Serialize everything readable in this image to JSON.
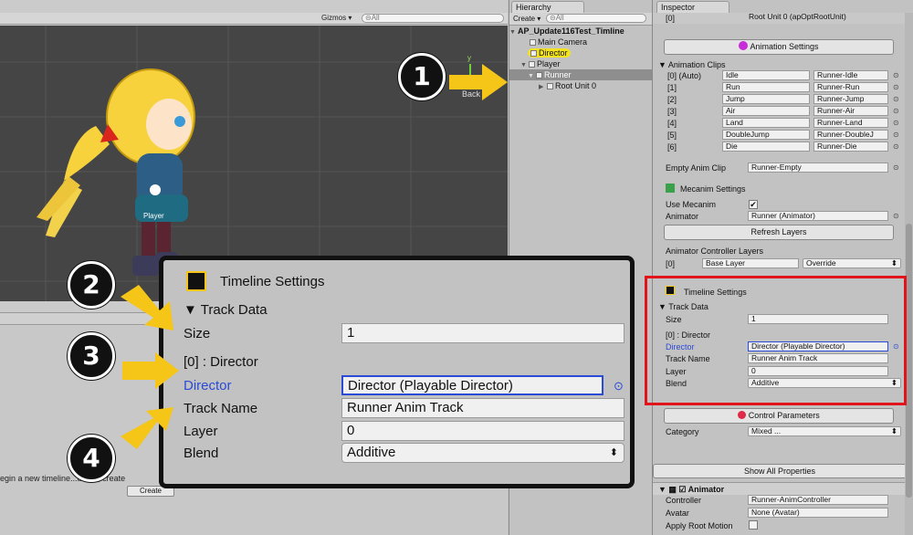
{
  "scene": {
    "gizmos_label": "Gizmos ▾",
    "search_placeholder": "⊝All",
    "gizmo_y": "y",
    "back_label": "Back",
    "player_label": "Player",
    "timeline_msg": "egin a new timeline...unner, create",
    "create_label": "Create"
  },
  "hierarchy": {
    "tab_label": "Hierarchy",
    "create_label": "Create ▾",
    "search_placeholder": "⊝All",
    "scene_name": "AP_Update116Test_Timline",
    "items": [
      {
        "label": "Main Camera"
      },
      {
        "label": "Director"
      },
      {
        "label": "Player"
      },
      {
        "label": "Runner"
      },
      {
        "label": "Root Unit 0"
      }
    ]
  },
  "inspector": {
    "tab_label": "Inspector",
    "top_index": "[0]",
    "top_value": "Root Unit 0 (apOptRootUnit)",
    "animation_settings_label": "Animation Settings",
    "animation_clips_label": "Animation Clips",
    "clips": [
      {
        "index": "[0] (Auto)",
        "name": "Idle",
        "ref": "Runner-Idle"
      },
      {
        "index": "[1]",
        "name": "Run",
        "ref": "Runner-Run"
      },
      {
        "index": "[2]",
        "name": "Jump",
        "ref": "Runner-Jump"
      },
      {
        "index": "[3]",
        "name": "Air",
        "ref": "Runner-Air"
      },
      {
        "index": "[4]",
        "name": "Land",
        "ref": "Runner-Land"
      },
      {
        "index": "[5]",
        "name": "DoubleJump",
        "ref": "Runner-DoubleJ"
      },
      {
        "index": "[6]",
        "name": "Die",
        "ref": "Runner-Die"
      }
    ],
    "empty_clip_label": "Empty Anim Clip",
    "empty_clip_value": "Runner-Empty",
    "mecanim_settings_label": "Mecanim Settings",
    "use_mecanim_label": "Use Mecanim",
    "animator_label": "Animator",
    "animator_value": "Runner (Animator)",
    "refresh_layers_label": "Refresh Layers",
    "controller_layers_label": "Animator Controller Layers",
    "layer_index": "[0]",
    "layer_name": "Base Layer",
    "layer_blend": "Override",
    "timeline_settings_label": "Timeline Settings",
    "track_data_label": "Track Data",
    "size_label": "Size",
    "size_value": "1",
    "track0_label": "[0] : Director",
    "director_label": "Director",
    "director_value": "Director (Playable Director)",
    "track_name_label": "Track Name",
    "track_name_value": "Runner Anim Track",
    "layer_label": "Layer",
    "layer_value": "0",
    "blend_label": "Blend",
    "blend_value": "Additive",
    "control_params_label": "Control Parameters",
    "category_label": "Category",
    "category_value": "Mixed ...",
    "show_all_label": "Show All Properties",
    "animator_comp_label": "Animator",
    "controller_label": "Controller",
    "controller_value": "Runner-AnimController",
    "avatar_label": "Avatar",
    "avatar_value": "None (Avatar)",
    "apply_root_motion_label": "Apply Root Motion"
  },
  "zoom": {
    "title": "Timeline Settings",
    "track_data_label": "Track Data",
    "size_label": "Size",
    "size_value": "1",
    "track0_label": "[0] : Director",
    "director_label": "Director",
    "director_value": "Director (Playable Director)",
    "track_name_label": "Track Name",
    "track_name_value": "Runner Anim Track",
    "layer_label": "Layer",
    "layer_value": "0",
    "blend_label": "Blend",
    "blend_value": "Additive"
  },
  "badges": [
    "1",
    "2",
    "3",
    "4"
  ],
  "colors": {
    "arrow_yellow": "#f5c518",
    "highlight_red": "#e0141a",
    "link_blue": "#2a4bd6"
  }
}
